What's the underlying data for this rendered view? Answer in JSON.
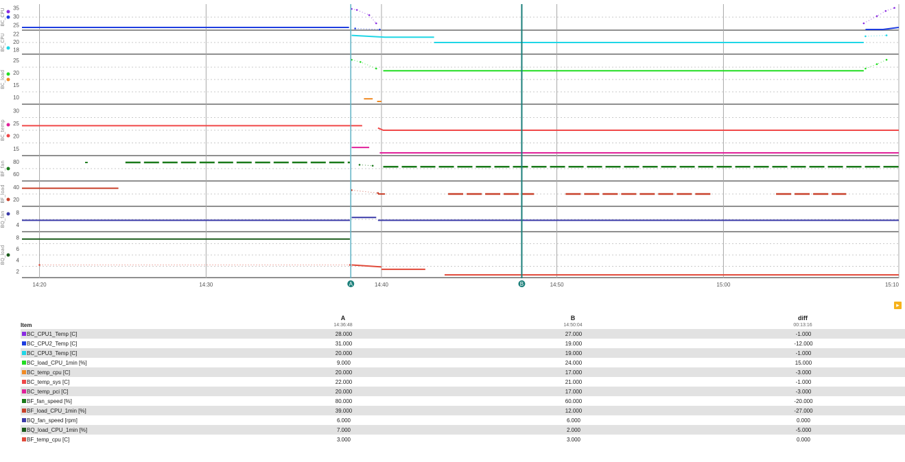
{
  "chart_data": {
    "type": "line",
    "title": "",
    "x_domain": [
      0,
      100
    ],
    "x_ticks": [
      {
        "x": 2,
        "label": "14:20"
      },
      {
        "x": 21,
        "label": "14:30"
      },
      {
        "x": 41,
        "label": "14:40"
      },
      {
        "x": 61,
        "label": "14:50"
      },
      {
        "x": 80,
        "label": "15:00"
      },
      {
        "x": 100,
        "label": "15:10"
      }
    ],
    "cursors": [
      {
        "name": "A",
        "x": 37.5,
        "color": "#5fb2c4",
        "badge": "A"
      },
      {
        "name": "B",
        "x": 57.0,
        "color": "#1b7f7a",
        "badge": "B"
      }
    ],
    "lanes": [
      {
        "label": "BC_CPU",
        "color": "#8a2be2",
        "h": 38,
        "y_ticks": [
          "35",
          "30",
          "25"
        ]
      },
      {
        "label": "BC_CPU",
        "color": "#1e3de0",
        "h": 0,
        "y_ticks": []
      },
      {
        "label": "BC_CPU",
        "color": "#1ed6e6",
        "h": 34,
        "y_ticks": [
          "22",
          "20",
          "18"
        ]
      },
      {
        "label": "BC_load",
        "color": "#22dd22",
        "h": 72,
        "y_ticks": [
          "25",
          "20",
          "15",
          "10"
        ]
      },
      {
        "label": "BC_temp",
        "color": "#f08a24",
        "h": 0,
        "y_ticks": []
      },
      {
        "label": "BC_temp",
        "color": "#f04848",
        "h": 74,
        "y_ticks": [
          "30",
          "25",
          "20",
          "15"
        ]
      },
      {
        "label": "BC_temp",
        "color": "#e0209a",
        "h": 0,
        "y_ticks": []
      },
      {
        "label": "BF_fan",
        "color": "#1a7a1a",
        "h": 36,
        "y_ticks": [
          "80",
          "60"
        ]
      },
      {
        "label": "BF_load",
        "color": "#c8402a",
        "h": 36,
        "y_ticks": [
          "40",
          "20"
        ]
      },
      {
        "label": "BQ_fan",
        "color": "#3a3aa8",
        "h": 36,
        "y_ticks": [
          "8",
          "4"
        ]
      },
      {
        "label": "BQ_load",
        "color": "#1a5a1a",
        "h": 66,
        "y_ticks": [
          "8",
          "6",
          "4",
          "2"
        ]
      }
    ],
    "series": [
      {
        "name": "BC_CPU1_Temp [C]",
        "color": "#8a2be2",
        "lane": 0,
        "segments": [
          {
            "points": [
              [
                37.6,
                0.9
              ],
              [
                38.2,
                0.85
              ],
              [
                39.6,
                0.6
              ],
              [
                40.4,
                0.2
              ]
            ],
            "style": "dots"
          },
          {
            "points": [
              [
                96.0,
                0.2
              ],
              [
                97.5,
                0.55
              ],
              [
                98.5,
                0.8
              ],
              [
                99.5,
                0.95
              ]
            ],
            "style": "dots"
          }
        ]
      },
      {
        "name": "BC_CPU2_Temp [C]",
        "color": "#1e3de0",
        "lane": 0,
        "segments": [
          {
            "points": [
              [
                0,
                0.0
              ],
              [
                37.3,
                0.0
              ]
            ],
            "style": "line"
          },
          {
            "points": [
              [
                38.0,
                -0.05
              ],
              [
                40.8,
                -0.1
              ]
            ],
            "style": "dots"
          },
          {
            "points": [
              [
                96.2,
                -0.1
              ],
              [
                98.2,
                -0.1
              ],
              [
                100,
                0.0
              ]
            ],
            "style": "line"
          }
        ]
      },
      {
        "name": "BC_CPU3_Temp [C]",
        "color": "#1ed6e6",
        "lane": 2,
        "segments": [
          {
            "points": [
              [
                37.6,
                0.9
              ],
              [
                41.4,
                0.8
              ],
              [
                47.0,
                0.8
              ]
            ],
            "style": "line"
          },
          {
            "points": [
              [
                47.0,
                0.5
              ],
              [
                96.0,
                0.5
              ]
            ],
            "style": "line"
          },
          {
            "points": [
              [
                96.2,
                0.85
              ],
              [
                98.6,
                0.9
              ]
            ],
            "style": "dots"
          }
        ]
      },
      {
        "name": "BC_load_CPU_1min [%]",
        "color": "#22dd22",
        "lane": 3,
        "segments": [
          {
            "points": [
              [
                37.6,
                0.95
              ],
              [
                38.6,
                0.9
              ],
              [
                40.4,
                0.75
              ]
            ],
            "style": "dots"
          },
          {
            "points": [
              [
                41.2,
                0.7
              ],
              [
                96.0,
                0.7
              ]
            ],
            "style": "line"
          },
          {
            "points": [
              [
                96.2,
                0.75
              ],
              [
                97.5,
                0.85
              ],
              [
                98.6,
                0.95
              ]
            ],
            "style": "dots"
          }
        ]
      },
      {
        "name": "BC_temp_cpu [C]",
        "color": "#f08a24",
        "lane": 3,
        "segments": [
          {
            "points": [
              [
                39.0,
                0.06
              ],
              [
                40.0,
                0.06
              ]
            ],
            "style": "line"
          },
          {
            "points": [
              [
                40.5,
                0.0
              ],
              [
                41.0,
                0.0
              ]
            ],
            "style": "line"
          }
        ]
      },
      {
        "name": "BC_temp_sys [C]",
        "color": "#f04848",
        "lane": 5,
        "segments": [
          {
            "points": [
              [
                0,
                0.6
              ],
              [
                38.8,
                0.6
              ]
            ],
            "style": "line"
          },
          {
            "points": [
              [
                40.6,
                0.55
              ],
              [
                41.2,
                0.5
              ],
              [
                100,
                0.5
              ]
            ],
            "style": "line"
          }
        ]
      },
      {
        "name": "BC_temp_pci [C]",
        "color": "#e0209a",
        "lane": 5,
        "segments": [
          {
            "points": [
              [
                37.6,
                0.12
              ],
              [
                39.6,
                0.12
              ]
            ],
            "style": "line"
          },
          {
            "points": [
              [
                40.8,
                0.0
              ],
              [
                100,
                0.0
              ]
            ],
            "style": "line"
          }
        ]
      },
      {
        "name": "BF_fan_speed [%]",
        "color": "#1a7a1a",
        "lane": 7,
        "segments": [
          {
            "points": [
              [
                7.2,
                0.82
              ],
              [
                7.5,
                0.82
              ]
            ],
            "style": "line"
          },
          {
            "points": [
              [
                11.8,
                0.82
              ],
              [
                37.4,
                0.82
              ]
            ],
            "style": "dash"
          },
          {
            "points": [
              [
                38.5,
                0.7
              ],
              [
                40.0,
                0.65
              ]
            ],
            "style": "dots"
          },
          {
            "points": [
              [
                41.2,
                0.6
              ],
              [
                100,
                0.6
              ]
            ],
            "style": "dash"
          }
        ]
      },
      {
        "name": "BF_load_CPU_1min [%]",
        "color": "#c8402a",
        "lane": 8,
        "segments": [
          {
            "points": [
              [
                0,
                0.8
              ],
              [
                11.0,
                0.8
              ]
            ],
            "style": "line"
          },
          {
            "points": [
              [
                37.6,
                0.7
              ],
              [
                40.6,
                0.55
              ]
            ],
            "style": "dots"
          },
          {
            "points": [
              [
                40.6,
                0.5
              ],
              [
                41.4,
                0.5
              ]
            ],
            "style": "line"
          },
          {
            "points": [
              [
                48.6,
                0.5
              ],
              [
                58.4,
                0.5
              ]
            ],
            "style": "dash"
          },
          {
            "points": [
              [
                62.0,
                0.5
              ],
              [
                78.6,
                0.5
              ]
            ],
            "style": "dash"
          },
          {
            "points": [
              [
                86.0,
                0.5
              ],
              [
                94.0,
                0.5
              ]
            ],
            "style": "dash"
          }
        ]
      },
      {
        "name": "BQ_fan_speed [rpm]",
        "color": "#3a3aa8",
        "lane": 9,
        "segments": [
          {
            "points": [
              [
                0,
                0.45
              ],
              [
                37.4,
                0.45
              ]
            ],
            "style": "line"
          },
          {
            "points": [
              [
                37.6,
                0.6
              ],
              [
                40.4,
                0.6
              ]
            ],
            "style": "line"
          },
          {
            "points": [
              [
                40.6,
                0.45
              ],
              [
                100,
                0.45
              ]
            ],
            "style": "line"
          }
        ]
      },
      {
        "name": "BQ_load_CPU_1min [%]",
        "color": "#1a5a1a",
        "lane": 10,
        "segments": [
          {
            "points": [
              [
                0,
                0.9
              ],
              [
                37.4,
                0.9
              ]
            ],
            "style": "line"
          }
        ]
      },
      {
        "name": "BF_temp_cpu [C]",
        "color": "#e04a3a",
        "lane": 10,
        "segments": [
          {
            "points": [
              [
                2,
                0.25
              ],
              [
                37.4,
                0.25
              ]
            ],
            "style": "dots"
          },
          {
            "points": [
              [
                37.6,
                0.25
              ],
              [
                41.0,
                0.2
              ]
            ],
            "style": "line"
          },
          {
            "points": [
              [
                41.0,
                0.14
              ],
              [
                46.0,
                0.14
              ]
            ],
            "style": "line"
          },
          {
            "points": [
              [
                48.2,
                0.0
              ],
              [
                100,
                0.0
              ]
            ],
            "style": "line"
          }
        ]
      }
    ]
  },
  "table": {
    "col_name_header": "Item",
    "columns": [
      {
        "header": "A",
        "sub": "14:36:48"
      },
      {
        "header": "B",
        "sub": "14:50:04"
      },
      {
        "header": "diff",
        "sub": "00:13:16"
      }
    ],
    "rows": [
      {
        "name": "BC_CPU1_Temp [C]",
        "color": "#8a2be2",
        "a": "28.000",
        "b": "27.000",
        "d": "-1.000"
      },
      {
        "name": "BC_CPU2_Temp [C]",
        "color": "#1e3de0",
        "a": "31.000",
        "b": "19.000",
        "d": "-12.000"
      },
      {
        "name": "BC_CPU3_Temp [C]",
        "color": "#1ed6e6",
        "a": "20.000",
        "b": "19.000",
        "d": "-1.000"
      },
      {
        "name": "BC_load_CPU_1min [%]",
        "color": "#22dd22",
        "a": "9.000",
        "b": "24.000",
        "d": "15.000"
      },
      {
        "name": "BC_temp_cpu [C]",
        "color": "#f08a24",
        "a": "20.000",
        "b": "17.000",
        "d": "-3.000"
      },
      {
        "name": "BC_temp_sys [C]",
        "color": "#f04848",
        "a": "22.000",
        "b": "21.000",
        "d": "-1.000"
      },
      {
        "name": "BC_temp_pci [C]",
        "color": "#e0209a",
        "a": "20.000",
        "b": "17.000",
        "d": "-3.000"
      },
      {
        "name": "BF_fan_speed [%]",
        "color": "#1a7a1a",
        "a": "80.000",
        "b": "60.000",
        "d": "-20.000"
      },
      {
        "name": "BF_load_CPU_1min [%]",
        "color": "#c8402a",
        "a": "39.000",
        "b": "12.000",
        "d": "-27.000"
      },
      {
        "name": "BQ_fan_speed [rpm]",
        "color": "#3a3aa8",
        "a": "6.000",
        "b": "6.000",
        "d": "0.000"
      },
      {
        "name": "BQ_load_CPU_1min [%]",
        "color": "#1a5a1a",
        "a": "7.000",
        "b": "2.000",
        "d": "-5.000"
      },
      {
        "name": "BF_temp_cpu [C]",
        "color": "#e04a3a",
        "a": "3.000",
        "b": "3.000",
        "d": "0.000"
      }
    ]
  },
  "controls": {
    "scroll_right": "▸"
  }
}
